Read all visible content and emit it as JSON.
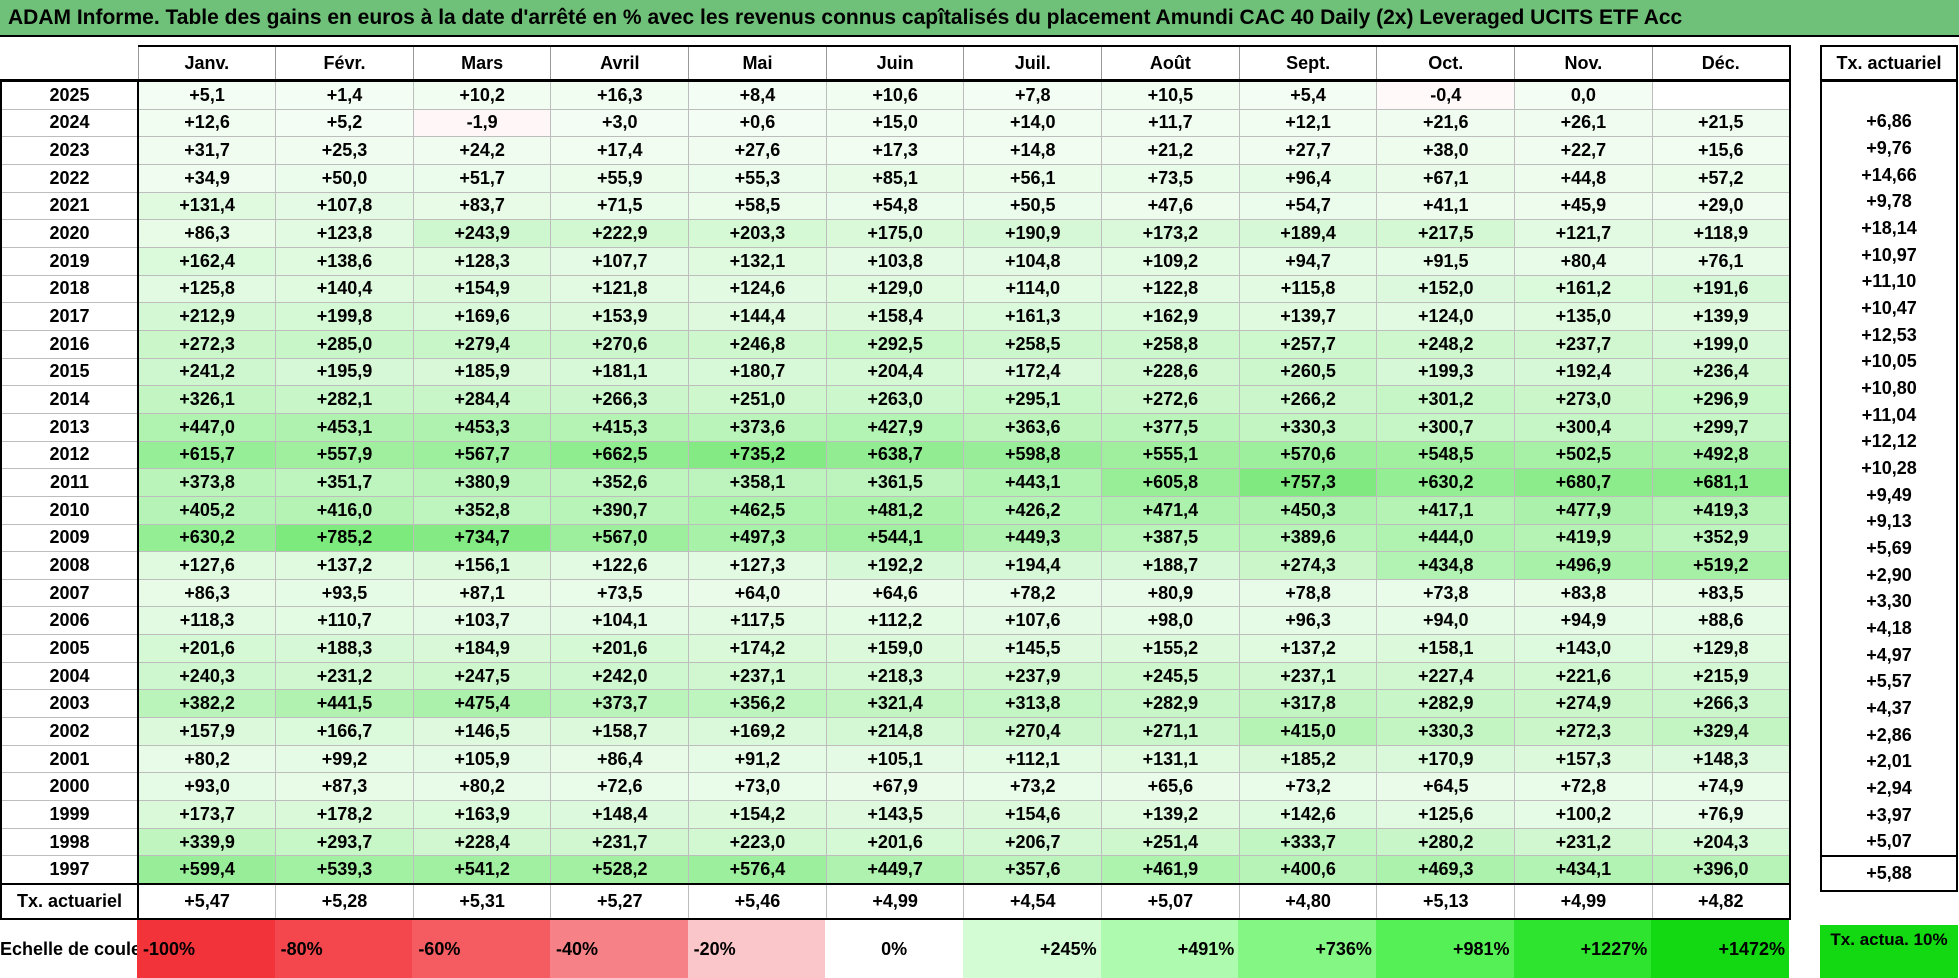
{
  "title": "ADAM Informe. Table des gains en euros à la date d'arrêté en % avec les revenus connus capîtalisés du placement Amundi CAC 40 Daily (2x) Leveraged UCITS ETF Acc",
  "months": [
    "Janv.",
    "Févr.",
    "Mars",
    "Avril",
    "Mai",
    "Juin",
    "Juil.",
    "Août",
    "Sept.",
    "Oct.",
    "Nov.",
    "Déc."
  ],
  "tx_header": "Tx. actuariel",
  "rows": [
    {
      "year": "2025",
      "values": [
        "+5,1",
        "+1,4",
        "+10,2",
        "+16,3",
        "+8,4",
        "+10,6",
        "+7,8",
        "+10,5",
        "+5,4",
        "-0,4",
        "0,0",
        ""
      ],
      "tx": ""
    },
    {
      "year": "2024",
      "values": [
        "+12,6",
        "+5,2",
        "-1,9",
        "+3,0",
        "+0,6",
        "+15,0",
        "+14,0",
        "+11,7",
        "+12,1",
        "+21,6",
        "+26,1",
        "+21,5"
      ],
      "tx": "+6,86"
    },
    {
      "year": "2023",
      "values": [
        "+31,7",
        "+25,3",
        "+24,2",
        "+17,4",
        "+27,6",
        "+17,3",
        "+14,8",
        "+21,2",
        "+27,7",
        "+38,0",
        "+22,7",
        "+15,6"
      ],
      "tx": "+9,76"
    },
    {
      "year": "2022",
      "values": [
        "+34,9",
        "+50,0",
        "+51,7",
        "+55,9",
        "+55,3",
        "+85,1",
        "+56,1",
        "+73,5",
        "+96,4",
        "+67,1",
        "+44,8",
        "+57,2"
      ],
      "tx": "+14,66"
    },
    {
      "year": "2021",
      "values": [
        "+131,4",
        "+107,8",
        "+83,7",
        "+71,5",
        "+58,5",
        "+54,8",
        "+50,5",
        "+47,6",
        "+54,7",
        "+41,1",
        "+45,9",
        "+29,0"
      ],
      "tx": "+9,78"
    },
    {
      "year": "2020",
      "values": [
        "+86,3",
        "+123,8",
        "+243,9",
        "+222,9",
        "+203,3",
        "+175,0",
        "+190,9",
        "+173,2",
        "+189,4",
        "+217,5",
        "+121,7",
        "+118,9"
      ],
      "tx": "+18,14"
    },
    {
      "year": "2019",
      "values": [
        "+162,4",
        "+138,6",
        "+128,3",
        "+107,7",
        "+132,1",
        "+103,8",
        "+104,8",
        "+109,2",
        "+94,7",
        "+91,5",
        "+80,4",
        "+76,1"
      ],
      "tx": "+10,97"
    },
    {
      "year": "2018",
      "values": [
        "+125,8",
        "+140,4",
        "+154,9",
        "+121,8",
        "+124,6",
        "+129,0",
        "+114,0",
        "+122,8",
        "+115,8",
        "+152,0",
        "+161,2",
        "+191,6"
      ],
      "tx": "+11,10"
    },
    {
      "year": "2017",
      "values": [
        "+212,9",
        "+199,8",
        "+169,6",
        "+153,9",
        "+144,4",
        "+158,4",
        "+161,3",
        "+162,9",
        "+139,7",
        "+124,0",
        "+135,0",
        "+139,9"
      ],
      "tx": "+10,47"
    },
    {
      "year": "2016",
      "values": [
        "+272,3",
        "+285,0",
        "+279,4",
        "+270,6",
        "+246,8",
        "+292,5",
        "+258,5",
        "+258,8",
        "+257,7",
        "+248,2",
        "+237,7",
        "+199,0"
      ],
      "tx": "+12,53"
    },
    {
      "year": "2015",
      "values": [
        "+241,2",
        "+195,9",
        "+185,9",
        "+181,1",
        "+180,7",
        "+204,4",
        "+172,4",
        "+228,6",
        "+260,5",
        "+199,3",
        "+192,4",
        "+236,4"
      ],
      "tx": "+10,05"
    },
    {
      "year": "2014",
      "values": [
        "+326,1",
        "+282,1",
        "+284,4",
        "+266,3",
        "+251,0",
        "+263,0",
        "+295,1",
        "+272,6",
        "+266,2",
        "+301,2",
        "+273,0",
        "+296,9"
      ],
      "tx": "+10,80"
    },
    {
      "year": "2013",
      "values": [
        "+447,0",
        "+453,1",
        "+453,3",
        "+415,3",
        "+373,6",
        "+427,9",
        "+363,6",
        "+377,5",
        "+330,3",
        "+300,7",
        "+300,4",
        "+299,7"
      ],
      "tx": "+11,04"
    },
    {
      "year": "2012",
      "values": [
        "+615,7",
        "+557,9",
        "+567,7",
        "+662,5",
        "+735,2",
        "+638,7",
        "+598,8",
        "+555,1",
        "+570,6",
        "+548,5",
        "+502,5",
        "+492,8"
      ],
      "tx": "+12,12"
    },
    {
      "year": "2011",
      "values": [
        "+373,8",
        "+351,7",
        "+380,9",
        "+352,6",
        "+358,1",
        "+361,5",
        "+443,1",
        "+605,8",
        "+757,3",
        "+630,2",
        "+680,7",
        "+681,1"
      ],
      "tx": "+10,28"
    },
    {
      "year": "2010",
      "values": [
        "+405,2",
        "+416,0",
        "+352,8",
        "+390,7",
        "+462,5",
        "+481,2",
        "+426,2",
        "+471,4",
        "+450,3",
        "+417,1",
        "+477,9",
        "+419,3"
      ],
      "tx": "+9,49"
    },
    {
      "year": "2009",
      "values": [
        "+630,2",
        "+785,2",
        "+734,7",
        "+567,0",
        "+497,3",
        "+544,1",
        "+449,3",
        "+387,5",
        "+389,6",
        "+444,0",
        "+419,9",
        "+352,9"
      ],
      "tx": "+9,13"
    },
    {
      "year": "2008",
      "values": [
        "+127,6",
        "+137,2",
        "+156,1",
        "+122,6",
        "+127,3",
        "+192,2",
        "+194,4",
        "+188,7",
        "+274,3",
        "+434,8",
        "+496,9",
        "+519,2"
      ],
      "tx": "+5,69"
    },
    {
      "year": "2007",
      "values": [
        "+86,3",
        "+93,5",
        "+87,1",
        "+73,5",
        "+64,0",
        "+64,6",
        "+78,2",
        "+80,9",
        "+78,8",
        "+73,8",
        "+83,8",
        "+83,5"
      ],
      "tx": "+2,90"
    },
    {
      "year": "2006",
      "values": [
        "+118,3",
        "+110,7",
        "+103,7",
        "+104,1",
        "+117,5",
        "+112,2",
        "+107,6",
        "+98,0",
        "+96,3",
        "+94,0",
        "+94,9",
        "+88,6"
      ],
      "tx": "+3,30"
    },
    {
      "year": "2005",
      "values": [
        "+201,6",
        "+188,3",
        "+184,9",
        "+201,6",
        "+174,2",
        "+159,0",
        "+145,5",
        "+155,2",
        "+137,2",
        "+158,1",
        "+143,0",
        "+129,8"
      ],
      "tx": "+4,18"
    },
    {
      "year": "2004",
      "values": [
        "+240,3",
        "+231,2",
        "+247,5",
        "+242,0",
        "+237,1",
        "+218,3",
        "+237,9",
        "+245,5",
        "+237,1",
        "+227,4",
        "+221,6",
        "+215,9"
      ],
      "tx": "+4,97"
    },
    {
      "year": "2003",
      "values": [
        "+382,2",
        "+441,5",
        "+475,4",
        "+373,7",
        "+356,2",
        "+321,4",
        "+313,8",
        "+282,9",
        "+317,8",
        "+282,9",
        "+274,9",
        "+266,3"
      ],
      "tx": "+5,57"
    },
    {
      "year": "2002",
      "values": [
        "+157,9",
        "+166,7",
        "+146,5",
        "+158,7",
        "+169,2",
        "+214,8",
        "+270,4",
        "+271,1",
        "+415,0",
        "+330,3",
        "+272,3",
        "+329,4"
      ],
      "tx": "+4,37"
    },
    {
      "year": "2001",
      "values": [
        "+80,2",
        "+99,2",
        "+105,9",
        "+86,4",
        "+91,2",
        "+105,1",
        "+112,1",
        "+131,1",
        "+185,2",
        "+170,9",
        "+157,3",
        "+148,3"
      ],
      "tx": "+2,86"
    },
    {
      "year": "2000",
      "values": [
        "+93,0",
        "+87,3",
        "+80,2",
        "+72,6",
        "+73,0",
        "+67,9",
        "+73,2",
        "+65,6",
        "+73,2",
        "+64,5",
        "+72,8",
        "+74,9"
      ],
      "tx": "+2,01"
    },
    {
      "year": "1999",
      "values": [
        "+173,7",
        "+178,2",
        "+163,9",
        "+148,4",
        "+154,2",
        "+143,5",
        "+154,6",
        "+139,2",
        "+142,6",
        "+125,6",
        "+100,2",
        "+76,9"
      ],
      "tx": "+2,94"
    },
    {
      "year": "1998",
      "values": [
        "+339,9",
        "+293,7",
        "+228,4",
        "+231,7",
        "+223,0",
        "+201,6",
        "+206,7",
        "+251,4",
        "+333,7",
        "+280,2",
        "+231,2",
        "+204,3"
      ],
      "tx": "+3,97"
    },
    {
      "year": "1997",
      "values": [
        "+599,4",
        "+539,3",
        "+541,2",
        "+528,2",
        "+576,4",
        "+449,7",
        "+357,6",
        "+461,9",
        "+400,6",
        "+469,3",
        "+434,1",
        "+396,0"
      ],
      "tx": "+5,07"
    }
  ],
  "avg_row": {
    "label": "Tx. actuariel",
    "values": [
      "+5,47",
      "+5,28",
      "+5,31",
      "+5,27",
      "+5,46",
      "+4,99",
      "+4,54",
      "+5,07",
      "+4,80",
      "+5,13",
      "+4,99",
      "+4,82"
    ],
    "tx": "+5,88"
  },
  "scale": {
    "label": "Echelle de couleur",
    "cells": [
      {
        "text": "-100%",
        "color": "#f2333a",
        "kind": "neg"
      },
      {
        "text": "-80%",
        "color": "#f3474d",
        "kind": "neg"
      },
      {
        "text": "-60%",
        "color": "#f45c62",
        "kind": "neg"
      },
      {
        "text": "-40%",
        "color": "#f68287",
        "kind": "neg"
      },
      {
        "text": "-20%",
        "color": "#fbc6c9",
        "kind": "neg"
      },
      {
        "text": "0%",
        "color": "#ffffff",
        "kind": "zero"
      },
      {
        "text": "+245%",
        "color": "#d3fbd4",
        "kind": "pos"
      },
      {
        "text": "+491%",
        "color": "#aefaae",
        "kind": "pos"
      },
      {
        "text": "+736%",
        "color": "#83f683",
        "kind": "pos"
      },
      {
        "text": "+981%",
        "color": "#55f055",
        "kind": "pos"
      },
      {
        "text": "+1227%",
        "color": "#2ee42e",
        "kind": "pos"
      },
      {
        "text": "+1472%",
        "color": "#13d913",
        "kind": "pos"
      }
    ],
    "tx_label": "Tx. actua. 10%",
    "tx_color": "#13d913"
  }
}
